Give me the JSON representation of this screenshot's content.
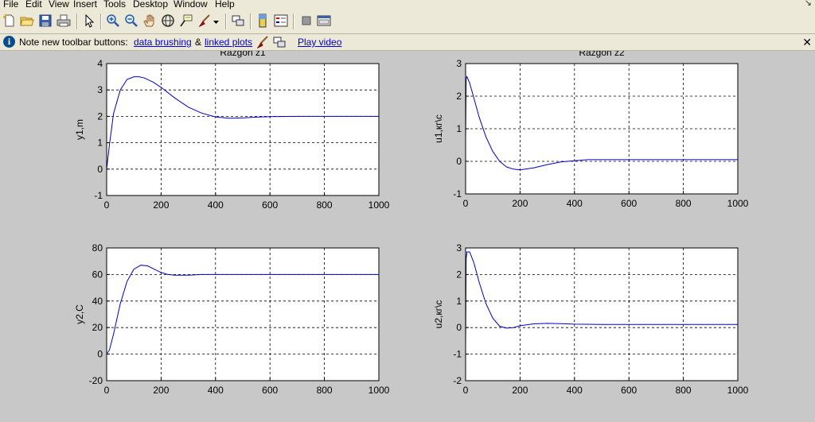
{
  "menu": [
    "File",
    "Edit",
    "View",
    "Insert",
    "Tools",
    "Desktop",
    "Window",
    "Help"
  ],
  "toolbar_icons": [
    "new-figure-icon",
    "open-file-icon",
    "save-icon",
    "print-icon",
    "edit-plot-arrow-icon",
    "zoom-in-icon",
    "zoom-out-icon",
    "pan-hand-icon",
    "rotate-3d-icon",
    "data-cursor-icon",
    "brush-icon",
    "link-plot-icon",
    "colorbar-icon",
    "legend-icon",
    "hide-plot-tools-icon",
    "show-plot-tools-icon"
  ],
  "infobar": {
    "text": "Note new toolbar buttons:",
    "link_brushing": "data brushing",
    "amp": "&",
    "link_linked": "linked plots",
    "link_video": "Play video",
    "close": "✕"
  },
  "colors": {
    "line": "#0000c8",
    "plot_bg": "#ffffff",
    "figure_bg": "#c8c8c8",
    "toolbar_bg": "#ece9d8"
  },
  "chart_data": [
    {
      "type": "line",
      "title": "Razgon z1",
      "xlabel": "",
      "ylabel": "y1,m",
      "xlim": [
        0,
        1000
      ],
      "ylim": [
        -1,
        4
      ],
      "xticks": [
        0,
        200,
        400,
        600,
        800,
        1000
      ],
      "yticks": [
        -1,
        0,
        1,
        2,
        3,
        4
      ],
      "grid": true,
      "x": [
        0,
        10,
        25,
        50,
        75,
        100,
        120,
        140,
        170,
        200,
        250,
        300,
        350,
        400,
        450,
        500,
        550,
        600,
        700,
        800,
        900,
        1000
      ],
      "y": [
        0,
        0.9,
        2.1,
        3.0,
        3.4,
        3.5,
        3.5,
        3.45,
        3.3,
        3.1,
        2.7,
        2.35,
        2.12,
        1.98,
        1.93,
        1.94,
        1.97,
        1.99,
        2.0,
        2.0,
        2.0,
        2.0
      ]
    },
    {
      "type": "line",
      "title": "Razgon z2",
      "xlabel": "",
      "ylabel": "u1,кг\\с",
      "xlim": [
        0,
        1000
      ],
      "ylim": [
        -1,
        3
      ],
      "xticks": [
        0,
        200,
        400,
        600,
        800,
        1000
      ],
      "yticks": [
        -1,
        0,
        1,
        2,
        3
      ],
      "grid": true,
      "x": [
        0,
        2,
        5,
        15,
        30,
        50,
        75,
        100,
        125,
        150,
        175,
        200,
        250,
        300,
        350,
        400,
        450,
        500,
        600,
        800,
        1000
      ],
      "y": [
        0.7,
        2.55,
        2.6,
        2.4,
        1.95,
        1.35,
        0.75,
        0.3,
        0.0,
        -0.17,
        -0.24,
        -0.26,
        -0.2,
        -0.1,
        -0.02,
        0.02,
        0.05,
        0.05,
        0.05,
        0.05,
        0.05
      ]
    },
    {
      "type": "line",
      "title": "",
      "xlabel": "",
      "ylabel": "y2,C",
      "xlim": [
        0,
        1000
      ],
      "ylim": [
        -20,
        80
      ],
      "xticks": [
        0,
        200,
        400,
        600,
        800,
        1000
      ],
      "yticks": [
        -20,
        0,
        20,
        40,
        60,
        80
      ],
      "grid": true,
      "x": [
        0,
        10,
        25,
        50,
        75,
        100,
        125,
        150,
        175,
        200,
        225,
        250,
        300,
        350,
        400,
        500,
        600,
        800,
        1000
      ],
      "y": [
        0,
        3,
        15,
        38,
        55,
        64,
        67,
        66.5,
        64,
        61.5,
        60,
        59.5,
        59.5,
        60,
        60,
        60,
        60,
        60,
        60
      ]
    },
    {
      "type": "line",
      "title": "",
      "xlabel": "",
      "ylabel": "u2,кг\\с",
      "xlim": [
        0,
        1000
      ],
      "ylim": [
        -2,
        3
      ],
      "xticks": [
        0,
        200,
        400,
        600,
        800,
        1000
      ],
      "yticks": [
        -2,
        -1,
        0,
        1,
        2,
        3
      ],
      "grid": true,
      "x": [
        0,
        2,
        5,
        15,
        30,
        50,
        75,
        100,
        125,
        150,
        175,
        200,
        250,
        300,
        350,
        400,
        500,
        600,
        800,
        1000
      ],
      "y": [
        -0.7,
        2.6,
        2.85,
        2.85,
        2.45,
        1.7,
        0.9,
        0.35,
        0.05,
        -0.02,
        0.0,
        0.07,
        0.14,
        0.16,
        0.15,
        0.13,
        0.12,
        0.12,
        0.12,
        0.12
      ]
    }
  ]
}
